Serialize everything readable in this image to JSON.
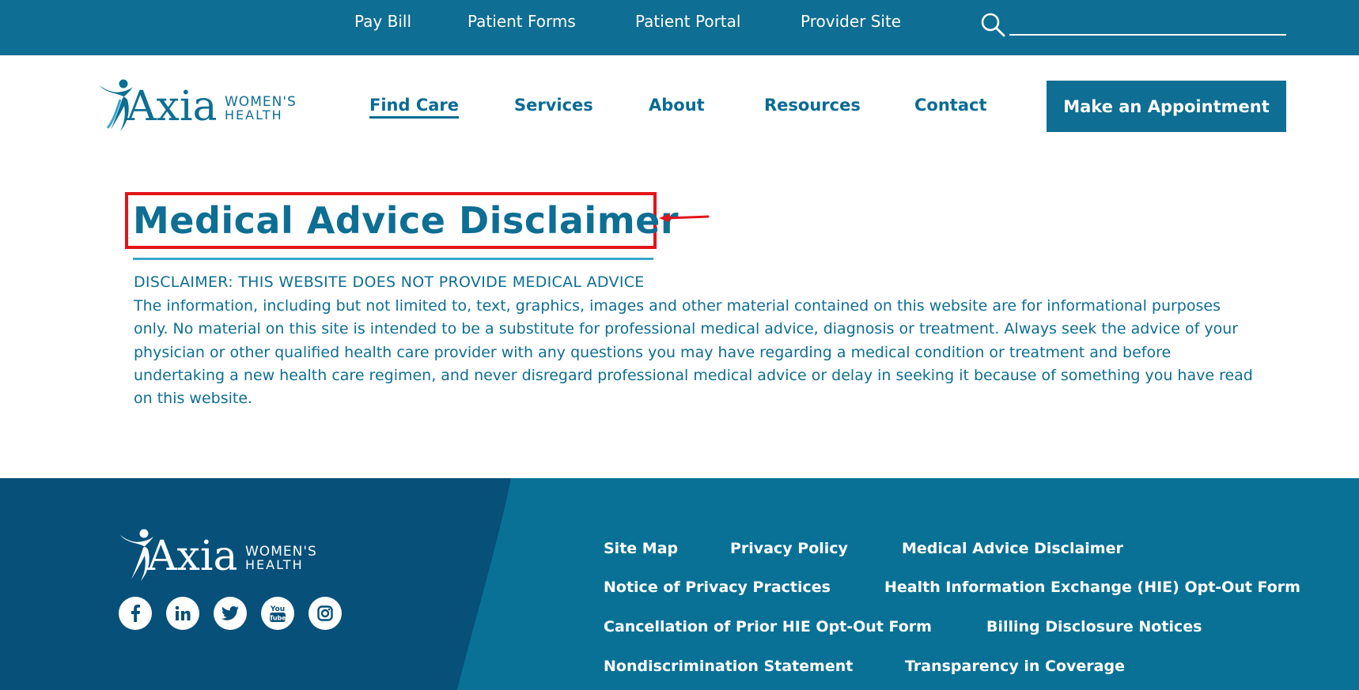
{
  "topbar": {
    "links": [
      "Pay Bill",
      "Patient Forms",
      "Patient Portal",
      "Provider Site"
    ],
    "search_value": ""
  },
  "brand": {
    "logo_wordmark": "Axia",
    "logo_tagline_1": "WOMEN'S",
    "logo_tagline_2": "HEALTH"
  },
  "nav": {
    "items": [
      "Find Care",
      "Services",
      "About",
      "Resources",
      "Contact"
    ],
    "active": "Find Care",
    "cta_label": "Make an Appointment"
  },
  "content": {
    "title": "Medical Advice Disclaimer",
    "disclaimer_heading": "DISCLAIMER: THIS WEBSITE DOES NOT PROVIDE MEDICAL ADVICE",
    "disclaimer_body": "The information, including but not limited to, text, graphics, images and other material contained on this website are for informational purposes only. No material on this site is intended to be a substitute for professional medical advice, diagnosis or treatment. Always seek the advice of your physician or other qualified health care provider with any questions you may have regarding a medical condition or treatment and before undertaking a new health care regimen, and never disregard professional medical advice or delay in seeking it because of something you have read on this website."
  },
  "footer": {
    "social_icons": [
      "facebook-icon",
      "linkedin-icon",
      "twitter-icon",
      "youtube-icon",
      "instagram-icon"
    ],
    "youtube_glyph_1": "You",
    "youtube_glyph_2": "Tube",
    "links": [
      "Site Map",
      "Privacy Policy",
      "Medical Advice Disclaimer",
      "Notice of Privacy Practices",
      "Health Information Exchange (HIE) Opt-Out Form",
      "Cancellation of Prior HIE Opt-Out Form",
      "Billing Disclosure Notices",
      "Nondiscrimination Statement",
      "Transparency in Coverage"
    ]
  },
  "colors": {
    "brand_teal": "#0e6e93",
    "footer_dark": "#06507a",
    "highlight_red": "#e3151a"
  }
}
